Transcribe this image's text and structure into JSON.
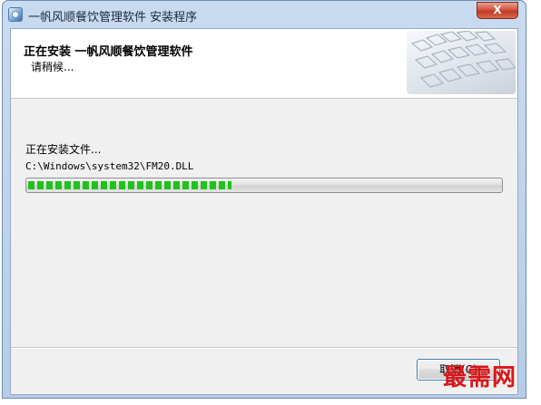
{
  "window": {
    "title": "一帆风顺餐饮管理软件 安装程序",
    "close_label": "X"
  },
  "header": {
    "title": "正在安装 一帆风顺餐饮管理软件",
    "subtitle": "请稍候..."
  },
  "main": {
    "status": "正在安装文件...",
    "current_file": "C:\\Windows\\system32\\FM20.DLL",
    "progress_fraction": 0.43
  },
  "footer": {
    "cancel_label": "取消(C)"
  },
  "watermark": {
    "text": "最需网",
    "color": "#d8161a"
  },
  "icons": {
    "app": "installer-app-icon",
    "close": "close-icon",
    "header_image": "keyboard-image"
  },
  "colors": {
    "progress": "#1fc21c",
    "close_button": "#c9442d"
  }
}
